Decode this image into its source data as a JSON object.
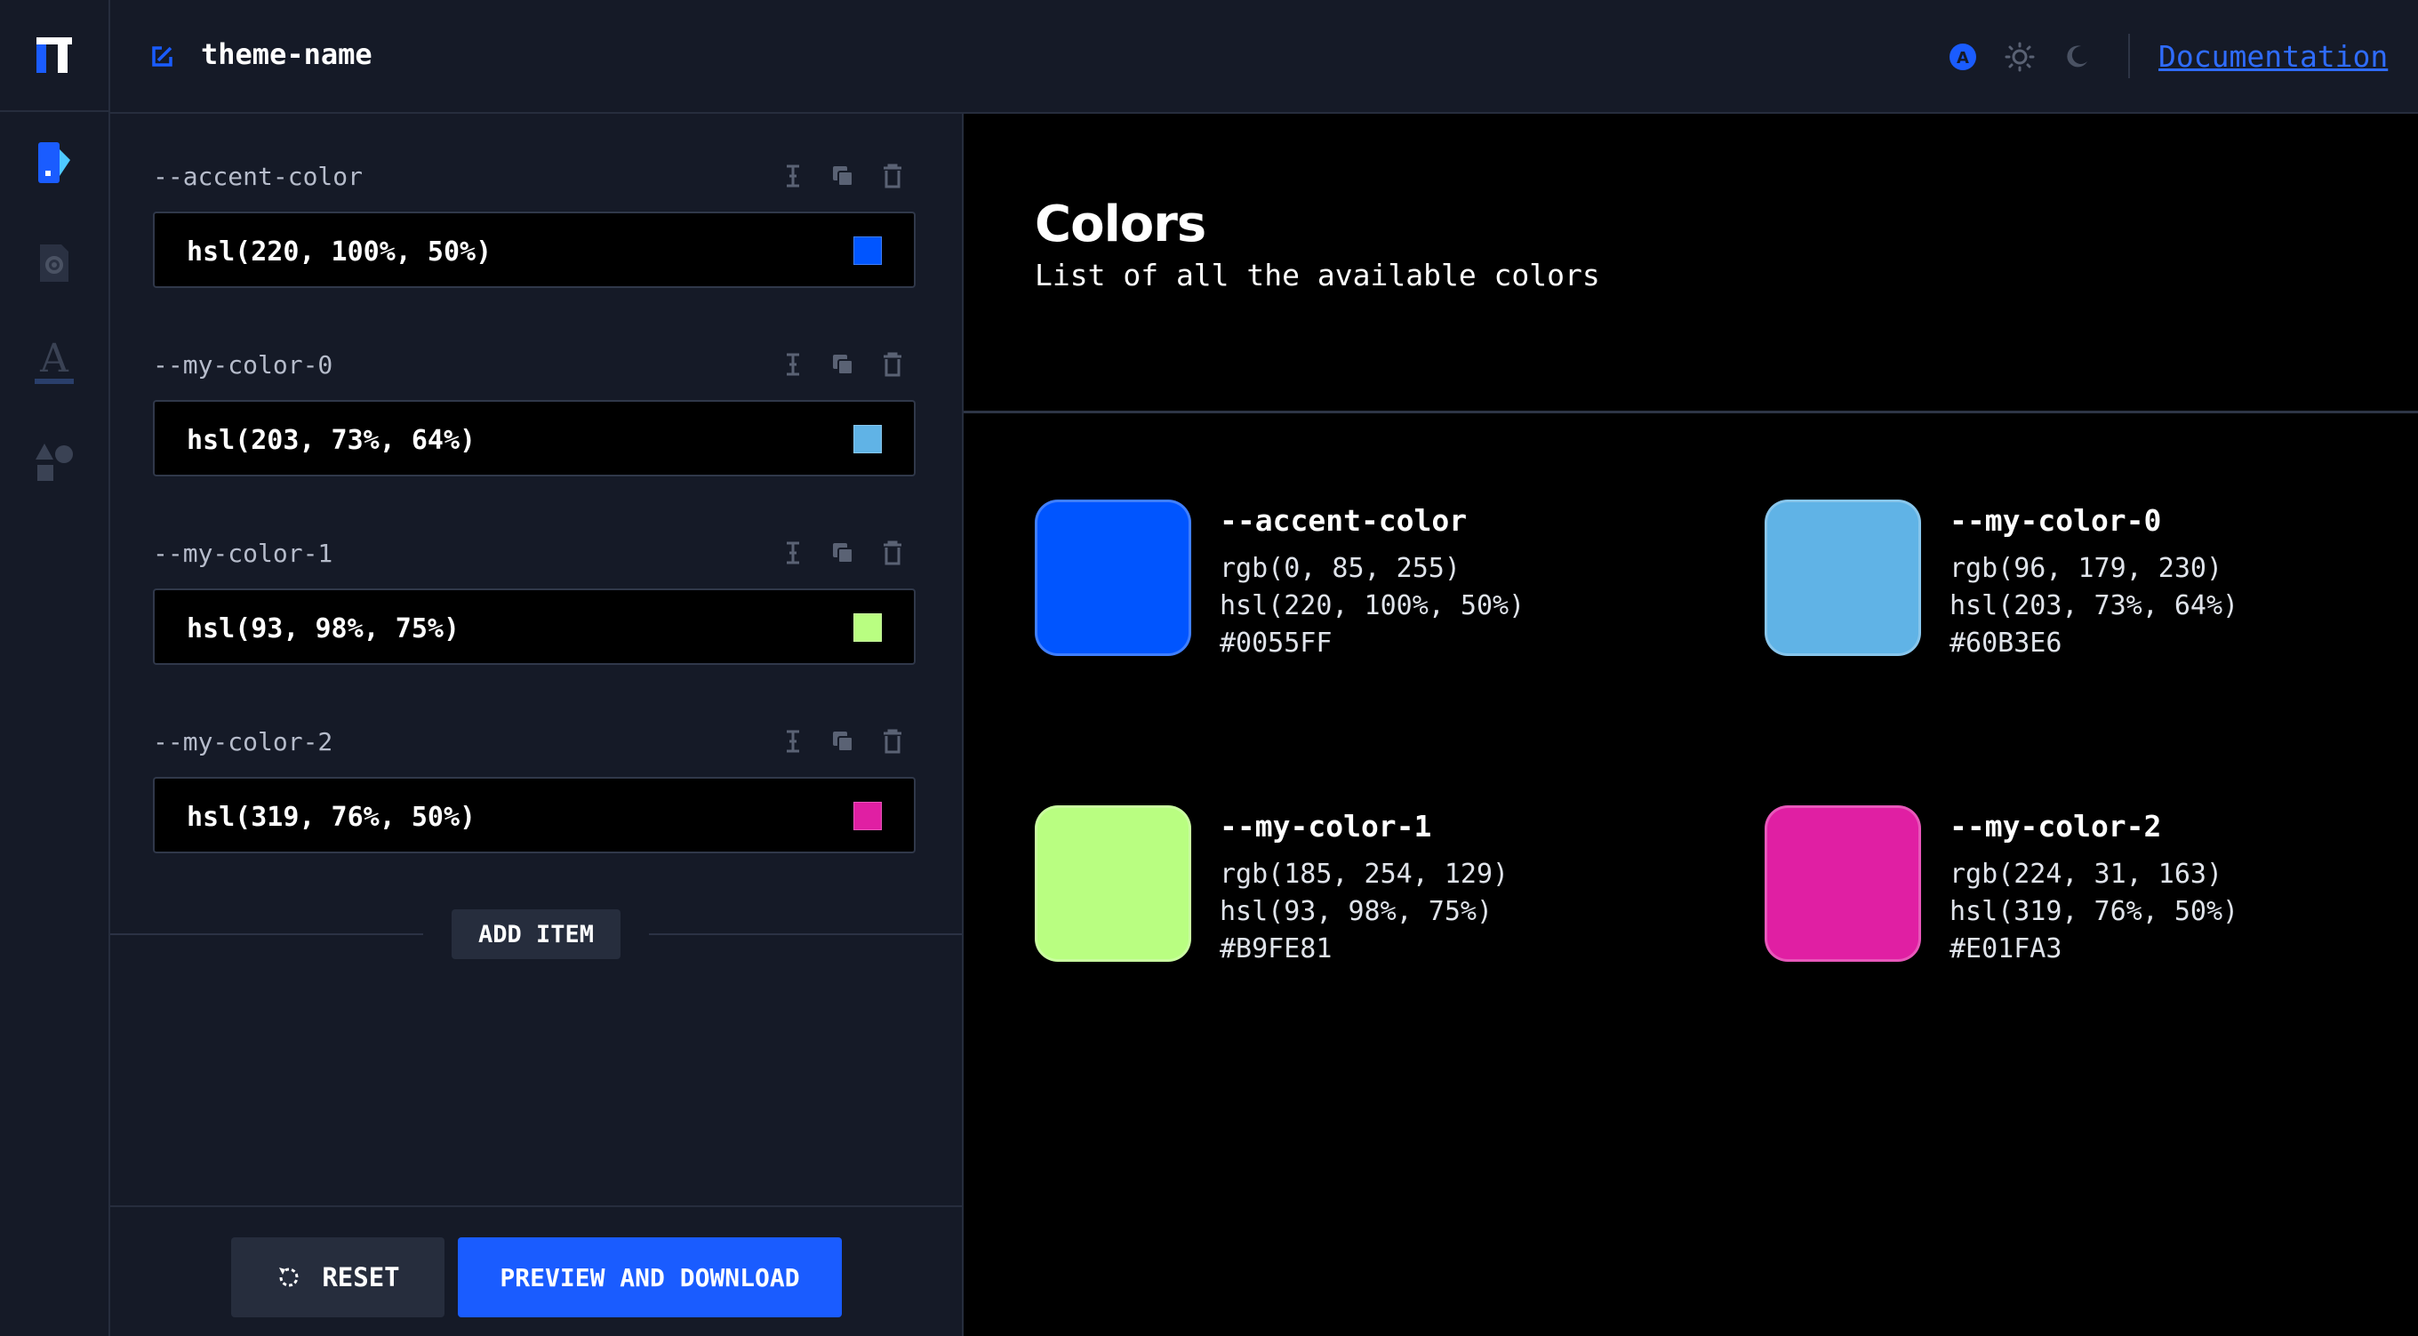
{
  "header": {
    "theme_name": "theme-name",
    "doc_link": "Documentation",
    "accent": "#1a5cff"
  },
  "sidebar": {
    "items": [
      {
        "name": "palette",
        "icon": "palette-icon",
        "active": true
      },
      {
        "name": "settings",
        "icon": "settings-doc-icon",
        "active": false
      },
      {
        "name": "typography",
        "icon": "typography-icon",
        "active": false
      },
      {
        "name": "shapes",
        "icon": "shapes-icon",
        "active": false
      }
    ]
  },
  "editor": {
    "variables": [
      {
        "label": "--accent-color",
        "value": "hsl(220, 100%, 50%)",
        "swatch": "#0055FF"
      },
      {
        "label": "--my-color-0",
        "value": "hsl(203, 73%, 64%)",
        "swatch": "#60B3E6"
      },
      {
        "label": "--my-color-1",
        "value": "hsl(93, 98%, 75%)",
        "swatch": "#B9FE81"
      },
      {
        "label": "--my-color-2",
        "value": "hsl(319, 76%, 50%)",
        "swatch": "#E01FA3"
      }
    ],
    "add_item": "ADD ITEM",
    "reset": "RESET",
    "preview_download": "PREVIEW AND DOWNLOAD"
  },
  "preview": {
    "title": "Colors",
    "subtitle": "List of all the available colors",
    "colors": [
      {
        "name": "--accent-color",
        "rgb": "rgb(0, 85, 255)",
        "hsl": "hsl(220, 100%, 50%)",
        "hex": "#0055FF"
      },
      {
        "name": "--my-color-0",
        "rgb": "rgb(96, 179, 230)",
        "hsl": "hsl(203, 73%, 64%)",
        "hex": "#60B3E6"
      },
      {
        "name": "--my-color-1",
        "rgb": "rgb(185, 254, 129)",
        "hsl": "hsl(93, 98%, 75%)",
        "hex": "#B9FE81"
      },
      {
        "name": "--my-color-2",
        "rgb": "rgb(224, 31, 163)",
        "hsl": "hsl(319, 76%, 50%)",
        "hex": "#E01FA3"
      }
    ]
  }
}
